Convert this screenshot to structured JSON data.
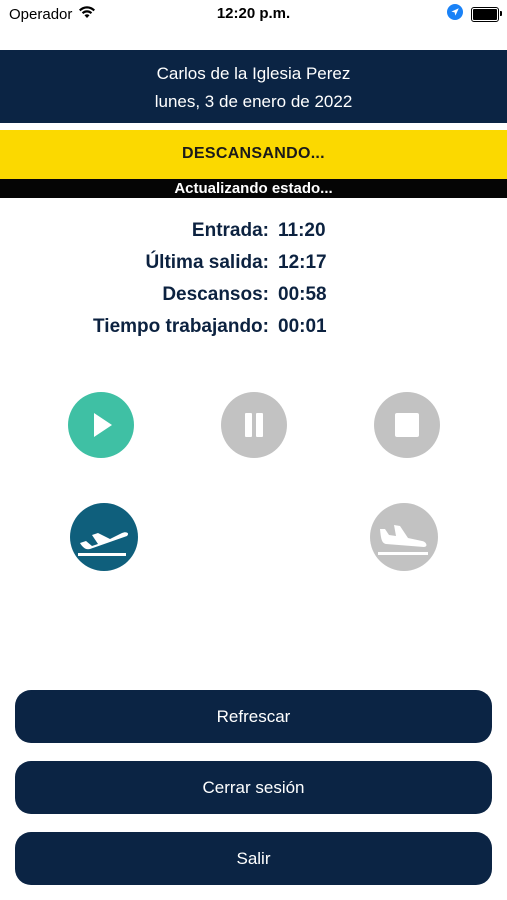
{
  "status_bar": {
    "carrier": "Operador",
    "time": "12:20 p.m."
  },
  "header": {
    "user_name": "Carlos de la Iglesia Perez",
    "date": "lunes, 3 de enero de 2022"
  },
  "status": {
    "label": "DESCANSANDO...",
    "updating": "Actualizando estado..."
  },
  "info": [
    {
      "label": "Entrada:",
      "value": "11:20"
    },
    {
      "label": "Última salida:",
      "value": "12:17"
    },
    {
      "label": "Descansos:",
      "value": "00:58"
    },
    {
      "label": "Tiempo trabajando:",
      "value": "00:01"
    }
  ],
  "actions": {
    "play_icon": "play-icon",
    "pause_icon": "pause-icon",
    "stop_icon": "stop-icon",
    "departure_icon": "airplane-departure-icon",
    "arrival_icon": "airplane-arrival-icon"
  },
  "colors": {
    "navy": "#0b2444",
    "banner_yellow": "#fbd900",
    "play_green": "#3fc0a4",
    "departure_teal": "#0f5f7c",
    "disabled_gray": "#c2c2c2"
  },
  "buttons": {
    "refresh": "Refrescar",
    "logout": "Cerrar sesión",
    "exit": "Salir"
  }
}
